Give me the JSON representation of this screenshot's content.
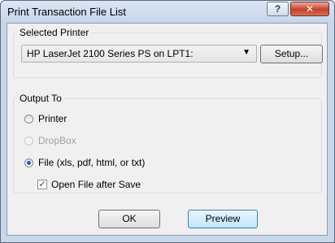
{
  "window": {
    "title": "Print Transaction File List",
    "help_label": "?",
    "close_label": "✕"
  },
  "selected_printer": {
    "legend": "Selected Printer",
    "printer_value": "HP LaserJet 2100 Series PS on LPT1:",
    "setup_label": "Setup..."
  },
  "output_to": {
    "legend": "Output To",
    "options": [
      {
        "label": "Printer",
        "selected": false,
        "enabled": true
      },
      {
        "label": "DropBox",
        "selected": false,
        "enabled": false
      },
      {
        "label": "File (xls, pdf, html, or txt)",
        "selected": true,
        "enabled": true
      }
    ],
    "open_after_save_label": "Open File after Save",
    "open_after_save_checked": true
  },
  "buttons": {
    "ok_label": "OK",
    "preview_label": "Preview"
  }
}
